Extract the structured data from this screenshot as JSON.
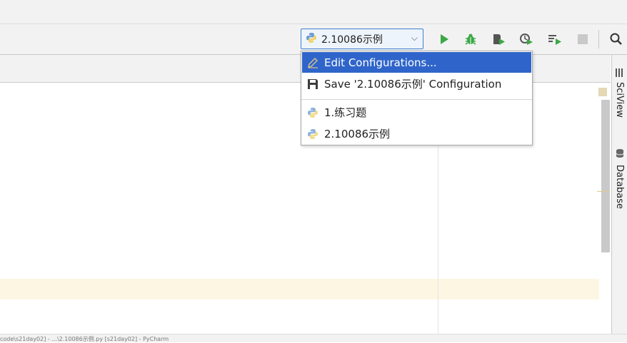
{
  "toolbar": {
    "run_config_label": "2.10086示例",
    "colors": {
      "run": "#3aa845",
      "debug": "#3aa845",
      "accent": "#2f65ca"
    }
  },
  "popup": {
    "items": [
      {
        "label": "Edit Configurations...",
        "icon": "pencil-icon",
        "selected": true
      },
      {
        "label": "Save '2.10086示例' Configuration",
        "icon": "save-icon",
        "selected": false
      },
      {
        "label": "1.练习题",
        "icon": "python-icon",
        "selected": false
      },
      {
        "label": "2.10086示例",
        "icon": "python-icon",
        "selected": false
      }
    ]
  },
  "right_tools": [
    {
      "label": "SciView",
      "icon": "sciview-icon"
    },
    {
      "label": "Database",
      "icon": "database-icon"
    }
  ],
  "status": {
    "text": "code\\s21day02] - ...\\2.10086示例.py [s21day02] - PyCharm"
  }
}
